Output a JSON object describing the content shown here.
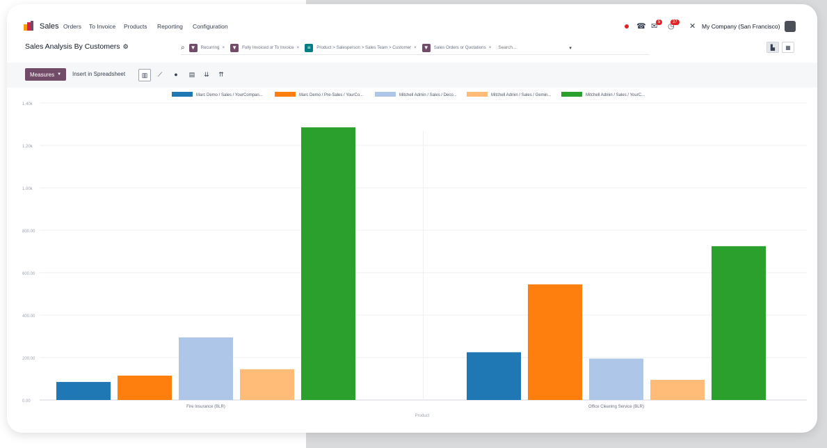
{
  "navbar": {
    "app_name": "Sales",
    "menu": [
      "Orders",
      "To Invoice",
      "Products",
      "Reporting",
      "Configuration"
    ],
    "company": "My Company (San Francisco)",
    "activity_badge": "37",
    "messages_badge": "5"
  },
  "view": {
    "title": "Sales Analysis By Customers",
    "search_placeholder": "Search...",
    "facets": [
      {
        "icon": "filter-icon",
        "color": "#714b67",
        "text": "Recurring"
      },
      {
        "icon": "filter-icon",
        "color": "#714b67",
        "text": "Fully Invoiced  or  To Invoice"
      },
      {
        "icon": "groupby-icon",
        "color": "#017e84",
        "text": "Product > Salesperson > Sales Team > Customer"
      },
      {
        "icon": "filter-icon",
        "color": "#714b67",
        "text": "Sales Orders  or  Quotations"
      }
    ]
  },
  "toolbar": {
    "measures_label": "Measures",
    "insert_label": "Insert in Spreadsheet"
  },
  "colors": {
    "brand": "#714b67",
    "series": [
      "#1f77b4",
      "#ff7f0e",
      "#aec7e8",
      "#ffbb78",
      "#2ca02c"
    ]
  },
  "chart_data": {
    "type": "bar",
    "categories": [
      "Fire Insurance (BLR)",
      "Office Cleaning Service (BLR)"
    ],
    "xlabel": "Product",
    "ylabel": "",
    "ylim": [
      0,
      1400
    ],
    "yticks": [
      "0.00",
      "200.00",
      "400.00",
      "600.00",
      "800.00",
      "1.00k",
      "1.20k",
      "1.40k"
    ],
    "legend_position": "top",
    "series": [
      {
        "name": "Marc Demo / Sales / YourCompan...",
        "values": [
          85,
          225
        ]
      },
      {
        "name": "Marc Demo / Pre-Sales / YourCo...",
        "values": [
          115,
          545
        ]
      },
      {
        "name": "Mitchell Admin / Sales / Deco...",
        "values": [
          295,
          195
        ]
      },
      {
        "name": "Mitchell Admin / Sales / Gemin...",
        "values": [
          145,
          95
        ]
      },
      {
        "name": "Mitchell Admin / Sales / YourC...",
        "values": [
          1285,
          725
        ]
      }
    ]
  }
}
